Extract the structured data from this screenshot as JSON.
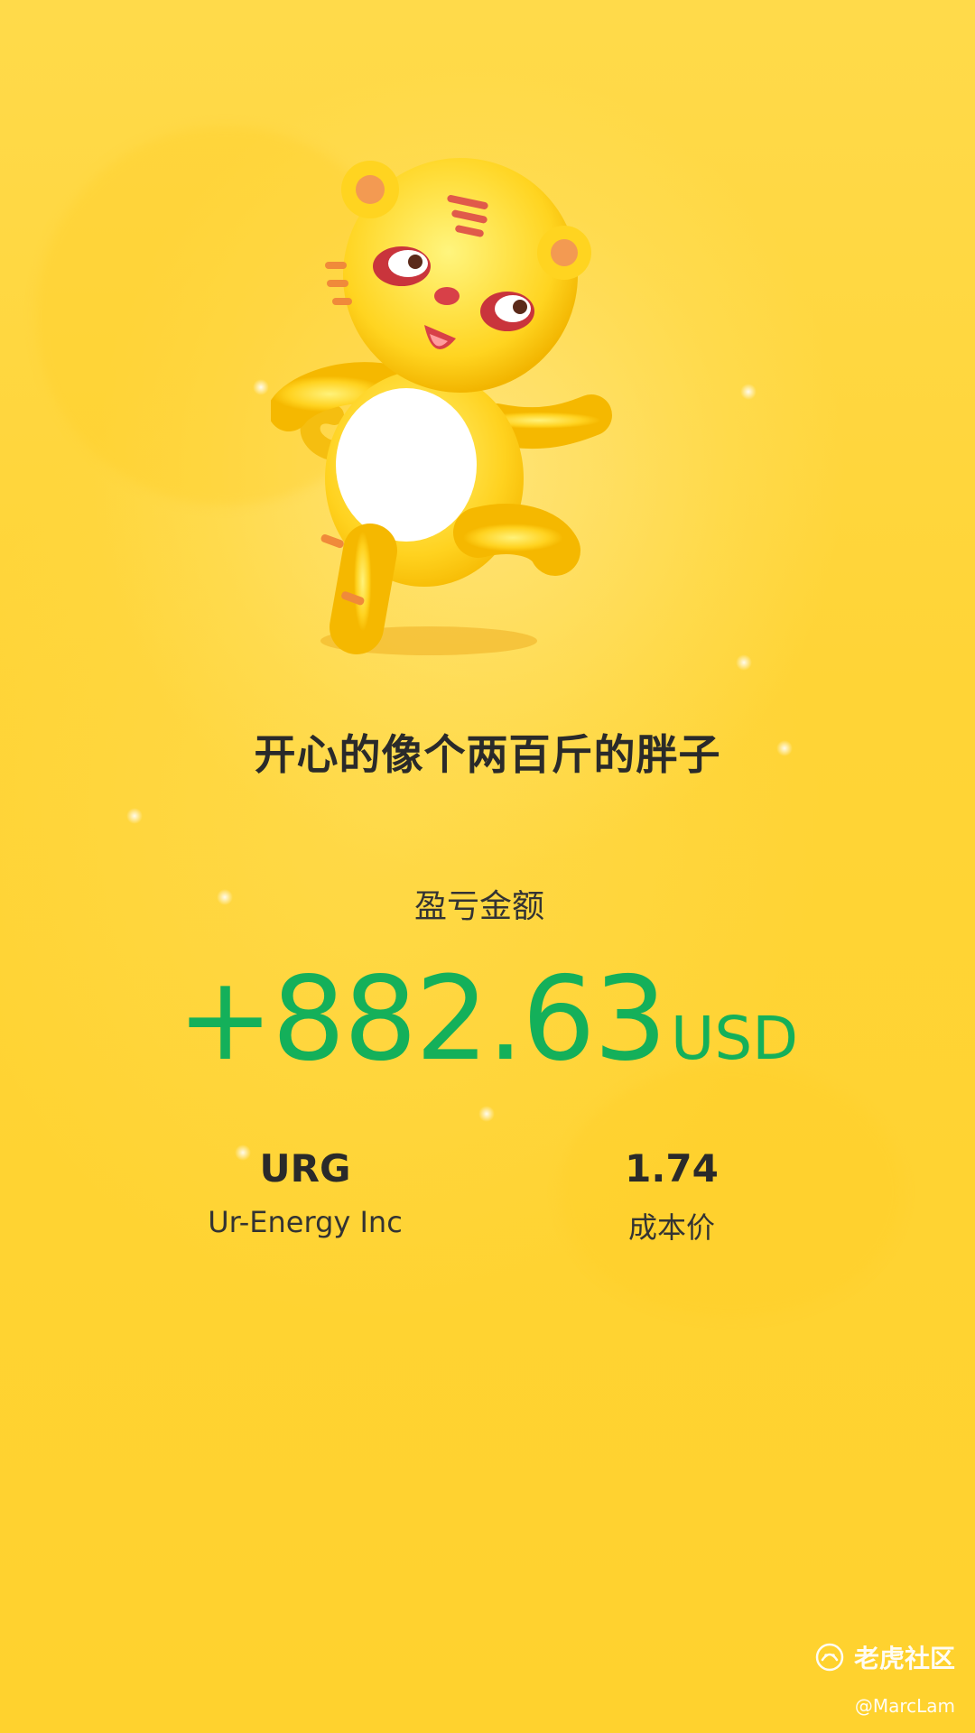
{
  "card": {
    "headline": "开心的像个两百斤的胖子",
    "pnl_label": "盈亏金额",
    "pnl_value": "+882.63",
    "pnl_unit": "USD",
    "pnl_color": "#14B05A"
  },
  "stock": {
    "symbol": "URG",
    "name": "Ur-Energy Inc"
  },
  "cost": {
    "value": "1.74",
    "label": "成本价"
  },
  "watermark": {
    "brand": "老虎社区",
    "user": "@MarcLam",
    "icon": "tiger-logo-icon"
  },
  "mascot": {
    "icon": "tiger-mascot-icon"
  },
  "colors": {
    "background": "#FFD533",
    "text": "#2a2a2a"
  }
}
